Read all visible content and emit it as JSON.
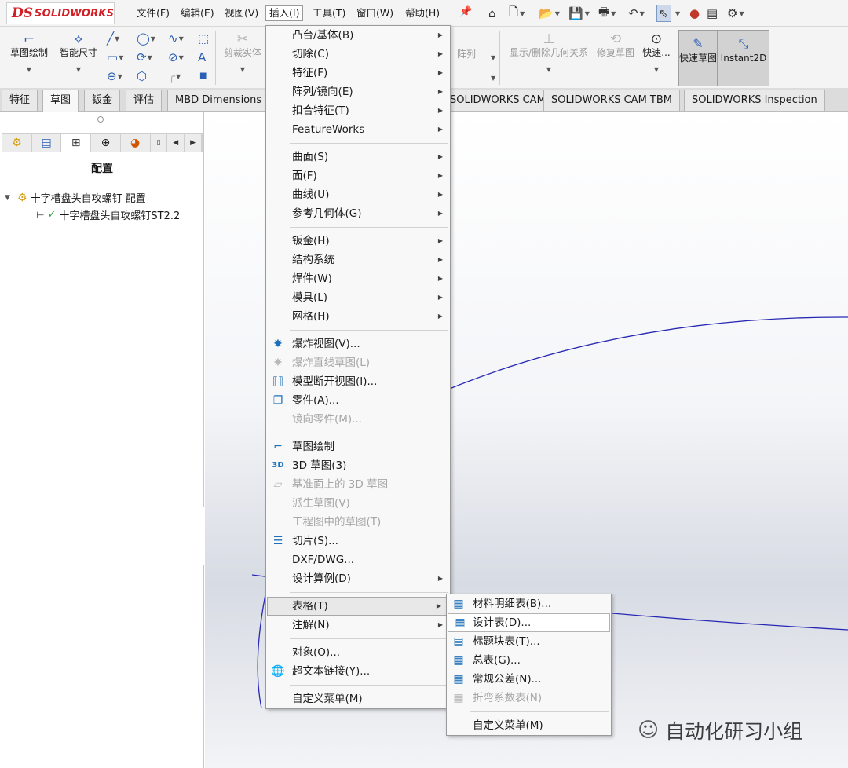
{
  "app": {
    "logo_ds": "DS",
    "logo_brand": "SOLIDWORKS"
  },
  "menubar": [
    "文件(F)",
    "编辑(E)",
    "视图(V)",
    "插入(I)",
    "工具(T)",
    "窗口(W)",
    "帮助(H)"
  ],
  "quick_access_icons": [
    "home-icon",
    "new-document-icon",
    "open-icon",
    "save-icon",
    "print-icon",
    "undo-icon",
    "select-icon",
    "traffic-light-icon",
    "properties-icon",
    "options-icon"
  ],
  "command_manager": {
    "sketch": "草图绘制",
    "smart_dimension": "智能尺寸",
    "trim": "剪裁实体",
    "pattern": "阵列",
    "show_hide_relations": "显示/删除几何关系",
    "repair_sketch": "修复草图",
    "quick_snaps": "快速...",
    "rapid_sketch": "快速草图",
    "instant2d": "Instant2D"
  },
  "tabs": [
    "特征",
    "草图",
    "钣金",
    "评估",
    "MBD Dimensions",
    "SOLIDWORKS CAM",
    "SOLIDWORKS CAM TBM",
    "SOLIDWORKS Inspection"
  ],
  "feature_manager": {
    "title": "配置",
    "tree": {
      "root": "十字槽盘头自攻螺钉 配置",
      "child": "十字槽盘头自攻螺钉ST2.2"
    }
  },
  "insert_menu": {
    "groups": [
      [
        {
          "label": "凸台/基体(B)",
          "sub": true
        },
        {
          "label": "切除(C)",
          "sub": true
        },
        {
          "label": "特征(F)",
          "sub": true
        },
        {
          "label": "阵列/镜向(E)",
          "sub": true
        },
        {
          "label": "扣合特征(T)",
          "sub": true
        },
        {
          "label": "FeatureWorks",
          "sub": true
        }
      ],
      [
        {
          "label": "曲面(S)",
          "sub": true
        },
        {
          "label": "面(F)",
          "sub": true
        },
        {
          "label": "曲线(U)",
          "sub": true
        },
        {
          "label": "参考几何体(G)",
          "sub": true
        }
      ],
      [
        {
          "label": "钣金(H)",
          "sub": true
        },
        {
          "label": "结构系统",
          "sub": true
        },
        {
          "label": "焊件(W)",
          "sub": true
        },
        {
          "label": "模具(L)",
          "sub": true
        },
        {
          "label": "网格(H)",
          "sub": true
        }
      ],
      [
        {
          "label": "爆炸视图(V)...",
          "icon": "explode-view-icon"
        },
        {
          "label": "爆炸直线草图(L)",
          "icon": "explode-line-icon",
          "disabled": true
        },
        {
          "label": "模型断开视图(I)...",
          "icon": "break-view-icon"
        },
        {
          "label": "零件(A)...",
          "icon": "part-icon"
        },
        {
          "label": "镜向零件(M)...",
          "disabled": true
        }
      ],
      [
        {
          "label": "草图绘制",
          "icon": "sketch-icon"
        },
        {
          "label": "3D 草图(3)",
          "icon": "sketch-3d-icon"
        },
        {
          "label": "基准面上的 3D 草图",
          "icon": "plane-sketch-3d-icon",
          "disabled": true
        },
        {
          "label": "派生草图(V)",
          "disabled": true
        },
        {
          "label": "工程图中的草图(T)",
          "disabled": true
        },
        {
          "label": "切片(S)...",
          "icon": "slice-icon"
        },
        {
          "label": "DXF/DWG..."
        },
        {
          "label": "设计算例(D)",
          "sub": true
        }
      ],
      [
        {
          "label": "表格(T)",
          "sub": true,
          "hover": true
        },
        {
          "label": "注解(N)",
          "sub": true
        }
      ],
      [
        {
          "label": "对象(O)..."
        },
        {
          "label": "超文本链接(Y)...",
          "icon": "hyperlink-icon"
        }
      ],
      [
        {
          "label": "自定义菜单(M)"
        }
      ]
    ]
  },
  "tables_submenu": {
    "groups": [
      [
        {
          "label": "材料明细表(B)...",
          "icon": "bom-icon"
        },
        {
          "label": "设计表(D)...",
          "icon": "design-table-icon",
          "highlight": true
        },
        {
          "label": "标题块表(T)...",
          "icon": "title-block-icon"
        },
        {
          "label": "总表(G)...",
          "icon": "general-table-icon"
        },
        {
          "label": "常规公差(N)...",
          "icon": "tolerance-icon"
        },
        {
          "label": "折弯系数表(N)",
          "icon": "bend-table-icon",
          "disabled": true
        }
      ],
      [
        {
          "label": "自定义菜单(M)"
        }
      ]
    ]
  },
  "watermark": "自动化研习小组"
}
